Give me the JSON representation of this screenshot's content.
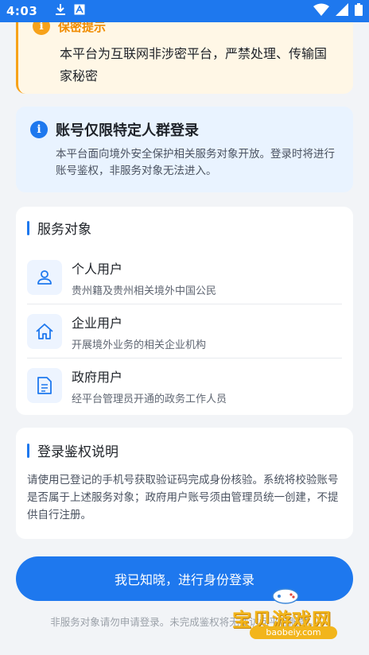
{
  "status_bar": {
    "time": "4:03",
    "left_icons": [
      "download-icon",
      "font-notification-icon"
    ],
    "right_icons": [
      "wifi-icon",
      "signal-icon",
      "battery-icon"
    ]
  },
  "warning": {
    "title": "保密提示",
    "text": "本平台为互联网非涉密平台，严禁处理、传输国家秘密",
    "icon_glyph": "i"
  },
  "info": {
    "title": "账号仅限特定人群登录",
    "text": "本平台面向境外安全保护相关服务对象开放。登录时将进行账号鉴权，非服务对象无法进入。",
    "icon_glyph": "i"
  },
  "services": {
    "title": "服务对象",
    "items": [
      {
        "icon": "person-icon",
        "name": "个人用户",
        "desc": "贵州籍及贵州相关境外中国公民"
      },
      {
        "icon": "home-icon",
        "name": "企业用户",
        "desc": "开展境外业务的相关企业机构"
      },
      {
        "icon": "document-icon",
        "name": "政府用户",
        "desc": "经平台管理员开通的政务工作人员"
      }
    ]
  },
  "auth": {
    "title": "登录鉴权说明",
    "text": "请使用已登记的手机号获取验证码完成身份核验。系统将校验账号是否属于上述服务对象；政府用户账号须由管理员统一创建，不提供自行注册。"
  },
  "login_button": {
    "label": "我已知晓，进行身份登录"
  },
  "footnote": "非服务对象请勿申请登录。未完成鉴权将无法访问平台服务。",
  "watermark": {
    "text": "宝贝游戏网",
    "url": "baobeiy.com"
  },
  "colors": {
    "primary": "#1e78ee",
    "warning": "#f7a21a",
    "warning_bg": "#fff7e6",
    "info_bg": "#e9f3ff",
    "page_bg": "#f2f4f7"
  }
}
